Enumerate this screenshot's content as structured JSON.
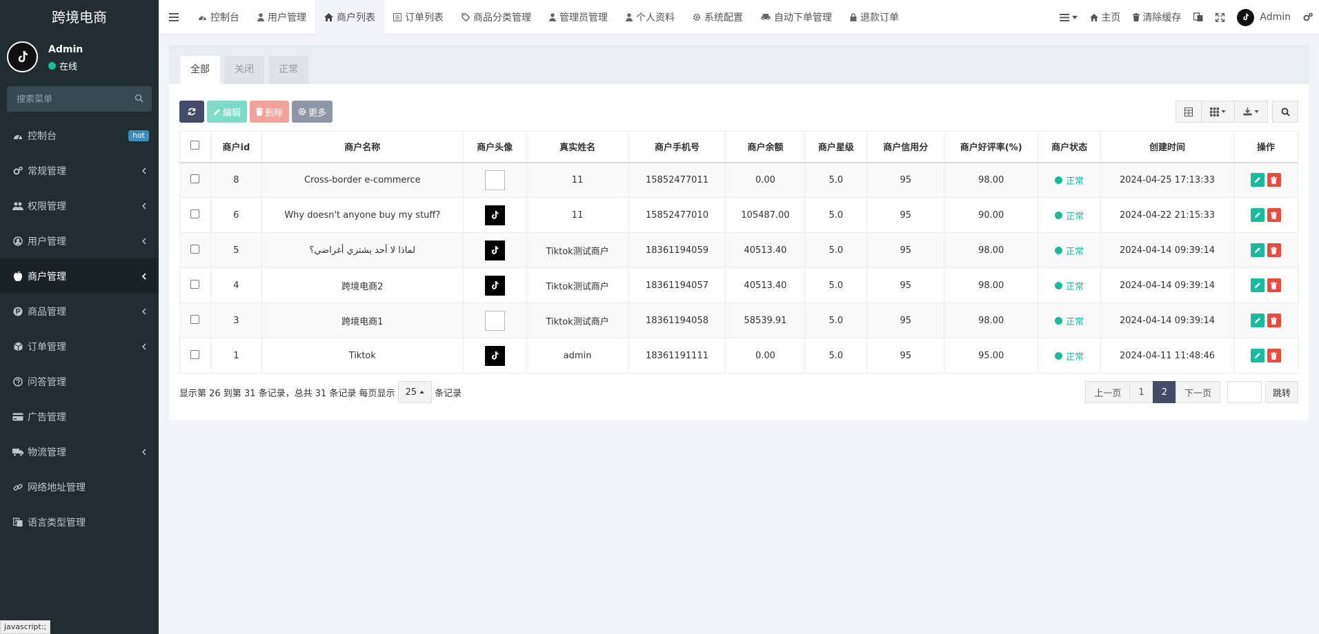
{
  "sidebar": {
    "logo": "跨境电商",
    "user": {
      "name": "Admin",
      "status": "在线"
    },
    "search_placeholder": "搜索菜单",
    "items": [
      {
        "label": "控制台",
        "badge": "hot"
      },
      {
        "label": "常规管理"
      },
      {
        "label": "权限管理"
      },
      {
        "label": "用户管理"
      },
      {
        "label": "商户管理"
      },
      {
        "label": "商品管理"
      },
      {
        "label": "订单管理"
      },
      {
        "label": "问答管理"
      },
      {
        "label": "广告管理"
      },
      {
        "label": "物流管理"
      },
      {
        "label": "网络地址管理"
      },
      {
        "label": "语言类型管理"
      }
    ]
  },
  "topbar": {
    "tabs": [
      "控制台",
      "用户管理",
      "商户列表",
      "订单列表",
      "商品分类管理",
      "管理员管理",
      "个人资料",
      "系统配置",
      "自动下单管理",
      "退款订单"
    ],
    "home": "主页",
    "clear_cache": "清除缓存",
    "admin": "Admin"
  },
  "filter_tabs": [
    "全部",
    "关闭",
    "正常"
  ],
  "toolbar": {
    "edit": "编辑",
    "delete": "删除",
    "more": "更多"
  },
  "table": {
    "headers": [
      "商户id",
      "商户名称",
      "商户头像",
      "真实姓名",
      "商户手机号",
      "商户余额",
      "商户星级",
      "商户信用分",
      "商户好评率(%)",
      "商户状态",
      "创建时间",
      "操作"
    ],
    "rows": [
      {
        "id": "8",
        "name": "Cross-border e-commerce",
        "avatar": "broken",
        "realname": "11",
        "phone": "15852477011",
        "balance": "0.00",
        "star": "5.0",
        "credit": "95",
        "rate": "98.00",
        "status": "正常",
        "created": "2024-04-25 17:13:33"
      },
      {
        "id": "6",
        "name": "Why doesn't anyone buy my stuff?",
        "avatar": "tiktok",
        "realname": "11",
        "phone": "15852477010",
        "balance": "105487.00",
        "star": "5.0",
        "credit": "95",
        "rate": "90.00",
        "status": "正常",
        "created": "2024-04-22 21:15:33"
      },
      {
        "id": "5",
        "name": "لماذا لا أحد يشتري أغراضي؟",
        "avatar": "tiktok",
        "realname": "Tiktok测试商户",
        "phone": "18361194059",
        "balance": "40513.40",
        "star": "5.0",
        "credit": "95",
        "rate": "98.00",
        "status": "正常",
        "created": "2024-04-14 09:39:14"
      },
      {
        "id": "4",
        "name": "跨境电商2",
        "avatar": "tiktok",
        "realname": "Tiktok测试商户",
        "phone": "18361194057",
        "balance": "40513.40",
        "star": "5.0",
        "credit": "95",
        "rate": "98.00",
        "status": "正常",
        "created": "2024-04-14 09:39:14"
      },
      {
        "id": "3",
        "name": "跨境电商1",
        "avatar": "broken",
        "realname": "Tiktok测试商户",
        "phone": "18361194058",
        "balance": "58539.91",
        "star": "5.0",
        "credit": "95",
        "rate": "98.00",
        "status": "正常",
        "created": "2024-04-14 09:39:14"
      },
      {
        "id": "1",
        "name": "Tiktok",
        "avatar": "tiktok",
        "realname": "admin",
        "phone": "18361191111",
        "balance": "0.00",
        "star": "5.0",
        "credit": "95",
        "rate": "95.00",
        "status": "正常",
        "created": "2024-04-11 11:48:46"
      }
    ]
  },
  "pager": {
    "info_prefix": "显示第 26 到第 31 条记录，总共 31 条记录 每页显示",
    "page_size": "25",
    "info_suffix": "条记录",
    "prev": "上一页",
    "pages": [
      "1",
      "2"
    ],
    "current": "2",
    "next": "下一页",
    "jump": "跳转"
  },
  "browser_status": "javascript:;",
  "colors": {
    "sidebar_bg": "#222d32",
    "accent": "#18bc9c",
    "primary": "#444c69",
    "danger": "#e74c3c"
  }
}
